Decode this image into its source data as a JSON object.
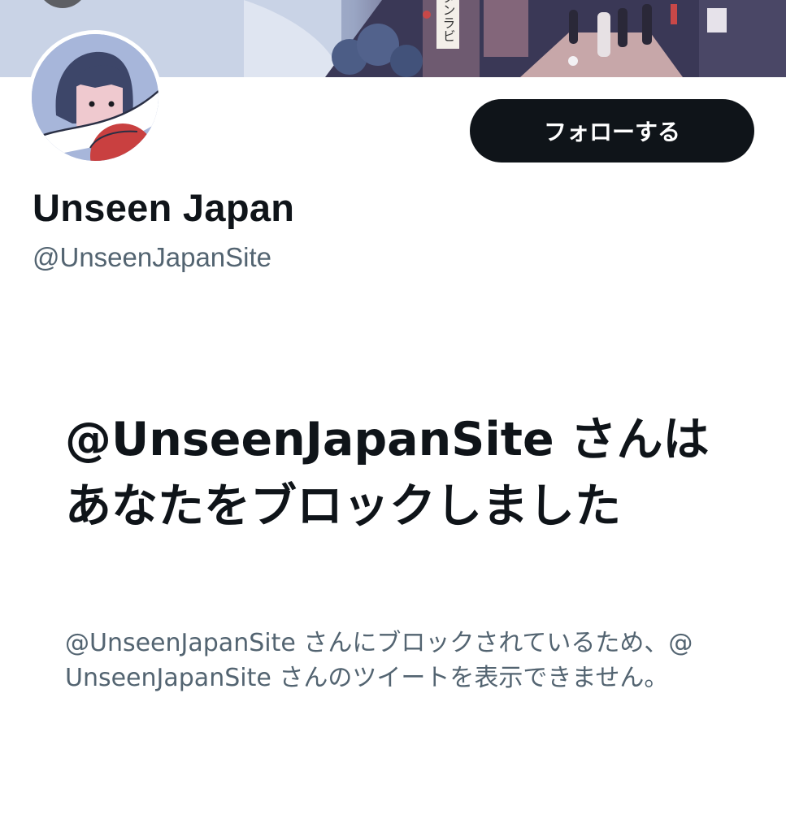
{
  "header": {
    "follow_button_label": "フォローする"
  },
  "profile": {
    "display_name": "Unseen Japan",
    "handle": "@UnseenJapanSite"
  },
  "blocked_notice": {
    "title": "@UnseenJapanSite さんはあなたをブロックしました",
    "description": "@UnseenJapanSite さんにブロックされているため、@UnseenJapanSite さんのツイートを表示できません。"
  },
  "banner": {
    "sign_text": "ダンラビ"
  },
  "colors": {
    "text_primary": "#0f1419",
    "text_secondary": "#536471",
    "button_bg": "#0f1419",
    "button_text": "#ffffff",
    "background": "#ffffff"
  },
  "icons": {
    "back": "arrow-left-icon"
  }
}
